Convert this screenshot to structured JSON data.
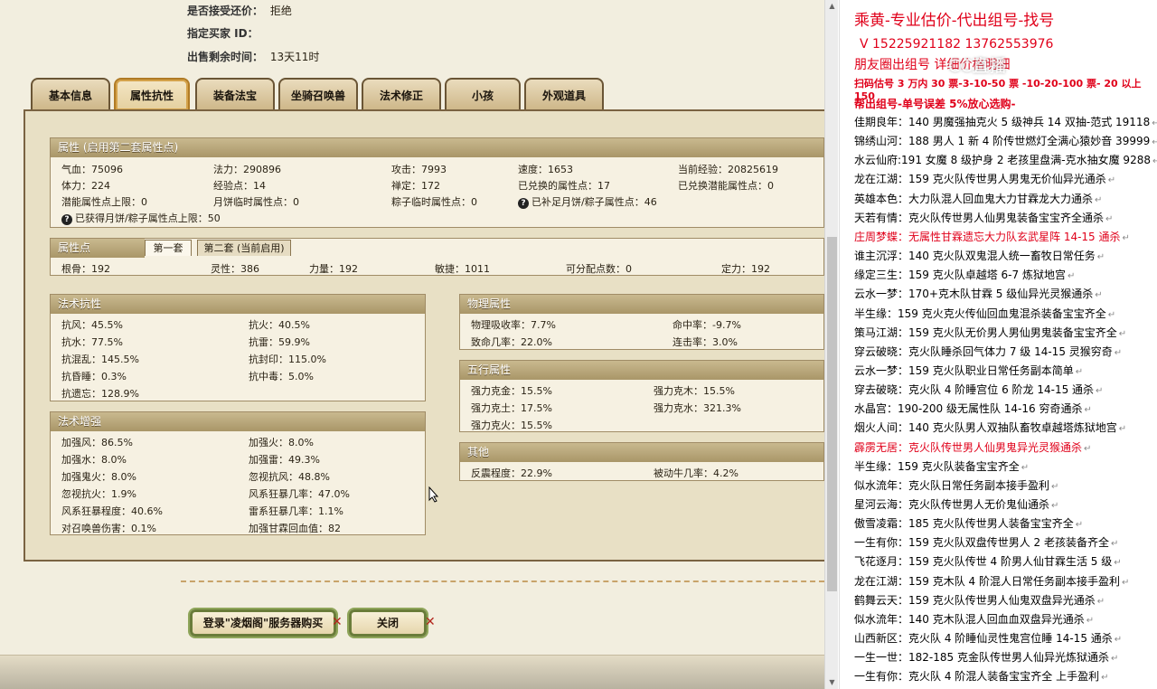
{
  "top_info": [
    {
      "label": "是否接受还价：",
      "value": "拒绝"
    },
    {
      "label": "指定买家 ID：",
      "value": ""
    },
    {
      "label": "出售剩余时间：",
      "value": "13天11时"
    }
  ],
  "tabs": [
    "基本信息",
    "属性抗性",
    "装备法宝",
    "坐骑召唤兽",
    "法术修正",
    "小孩",
    "外观道具"
  ],
  "attr_panel": {
    "title": "属性 (启用第二套属性点)",
    "rows": [
      [
        "气血：75096",
        "法力：290896",
        "攻击：7993",
        "速度：1653",
        "当前经验：20825619"
      ],
      [
        "体力：224",
        "经验点：14",
        "禅定：172",
        "已兑换的属性点：17",
        "已兑换潜能属性点：0"
      ],
      [
        "潜能属性点上限：0",
        "月饼临时属性点：0",
        "粽子临时属性点：0",
        "已补足月饼/粽子属性点：46",
        ""
      ],
      [
        "已获得月饼/粽子属性点上限：50",
        "",
        "",
        "",
        ""
      ]
    ]
  },
  "points_panel": {
    "title": "属性点",
    "subtab1": "第一套",
    "subtab2": "第二套 (当前启用)",
    "items": [
      "根骨：192",
      "灵性：386",
      "力量：192",
      "敏捷：1011",
      "可分配点数：0",
      "定力：192"
    ]
  },
  "magic_res": {
    "title": "法术抗性",
    "items": [
      "抗风：45.5%",
      "抗火：40.5%",
      "抗水：77.5%",
      "抗雷：59.9%",
      "抗混乱：145.5%",
      "抗封印：115.0%",
      "抗昏睡：0.3%",
      "抗中毒：5.0%",
      "抗遗忘：128.9%"
    ]
  },
  "magic_boost": {
    "title": "法术增强",
    "items": [
      "加强风：86.5%",
      "加强火：8.0%",
      "加强水：8.0%",
      "加强雷：49.3%",
      "加强鬼火：8.0%",
      "忽视抗风：48.8%",
      "忽视抗火：1.9%",
      "风系狂暴几率：47.0%",
      "风系狂暴程度：40.6%",
      "雷系狂暴几率：1.1%",
      "对召唤兽伤害：0.1%",
      "加强甘霖回血值：82"
    ]
  },
  "physical": {
    "title": "物理属性",
    "items": [
      "物理吸收率：7.7%",
      "命中率：-9.7%",
      "致命几率：22.0%",
      "连击率：3.0%"
    ]
  },
  "five_elements": {
    "title": "五行属性",
    "items": [
      "强力克金：15.5%",
      "强力克木：15.5%",
      "强力克土：17.5%",
      "强力克水：321.3%",
      "强力克火：15.5%"
    ]
  },
  "other": {
    "title": "其他",
    "items": [
      "反震程度：22.9%",
      "被动牛几率：4.2%"
    ]
  },
  "buttons": {
    "buy": "登录\"凌烟阁\"服务器购买",
    "close": "关闭"
  },
  "right": {
    "title": "乘黄-专业估价-代出组号-找号",
    "phones": "V 15225921182   13762553976",
    "moments": "朋友圈出组号   详细价格明细",
    "watermark": "CC直播",
    "price": "扫码估号 3 万内 30 票-3-10-50 票  -10-20-100 票- 20 以上 150",
    "guarantee": "帮出组号-单号误差 5%放心选购-",
    "listings": [
      {
        "text": "佳期良年：140 男魔强抽克火 5 级神兵 14 双抽-范式 19118",
        "red": false
      },
      {
        "text": "锦绣山河：188 男人 1 新 4 阶传世燃灯全满心猿妙音 39999",
        "red": false
      },
      {
        "text": "水云仙府:191 女魔 8 级护身 2 老孩里盘满-克水抽女魔 9288",
        "red": false
      },
      {
        "text": "龙在江湖：159 克火队传世男人男鬼无价仙异光通杀",
        "red": false
      },
      {
        "text": "英雄本色：大力队混人回血鬼大力甘霖龙大力通杀",
        "red": false
      },
      {
        "text": "天若有情：克火队传世男人仙男鬼装备宝宝齐全通杀",
        "red": false
      },
      {
        "text": "庄周梦蝶：无属性甘霖遗忘大力队玄武星阵 14-15 通杀",
        "red": true
      },
      {
        "text": "谁主沉浮：140 克火队双鬼混人统一畜牧日常任务",
        "red": false
      },
      {
        "text": "缘定三生：159 克火队卓越塔 6-7 炼狱地宫",
        "red": false
      },
      {
        "text": "云水一梦：170+克木队甘霖 5 级仙异光灵猴通杀",
        "red": false
      },
      {
        "text": "半生缘：159 克火克火传仙回血鬼混杀装备宝宝齐全",
        "red": false
      },
      {
        "text": "策马江湖：159 克火队无价男人男仙男鬼装备宝宝齐全",
        "red": false
      },
      {
        "text": "穿云破晓：克火队睡杀回气体力 7 级 14-15 灵猴穷奇",
        "red": false
      },
      {
        "text": "云水一梦：159 克火队职业日常任务副本简单",
        "red": false
      },
      {
        "text": "穿去破晓：克火队 4 阶睡宫位 6 阶龙 14-15 通杀",
        "red": false
      },
      {
        "text": "水晶宫：190-200 级无属性队 14-16 穷奇通杀",
        "red": false
      },
      {
        "text": "烟火人间：140 克火队男人双抽队畜牧卓越塔炼狱地宫",
        "red": false
      },
      {
        "text": "霹雳无居：克火队传世男人仙男鬼异光灵猴通杀",
        "red": true
      },
      {
        "text": "半生缘：159 克火队装备宝宝齐全",
        "red": false
      },
      {
        "text": "似水流年：克火队日常任务副本接手盈利",
        "red": false
      },
      {
        "text": "星河云海：克火队传世男人无价鬼仙通杀",
        "red": false
      },
      {
        "text": "傲雪凌霜：185 克火队传世男人装备宝宝齐全",
        "red": false
      },
      {
        "text": "一生有你：159 克火队双盘传世男人 2 老孩装备齐全",
        "red": false
      },
      {
        "text": "飞花逐月：159 克火队传世 4 阶男人仙甘霖生活 5 级",
        "red": false
      },
      {
        "text": "龙在江湖：159 克木队 4 阶混人日常任务副本接手盈利",
        "red": false
      },
      {
        "text": "鹤舞云天：159 克火队传世男人仙鬼双盘异光通杀",
        "red": false
      },
      {
        "text": "似水流年：140 克木队混人回血血双盘异光通杀",
        "red": false
      },
      {
        "text": "山西新区：克火队 4 阶睡仙灵性鬼宫位睡 14-15 通杀",
        "red": false
      },
      {
        "text": "一生一世：182-185 克金队传世男人仙异光炼狱通杀",
        "red": false
      },
      {
        "text": "一生有你：克火队 4 阶混人装备宝宝齐全 上手盈利",
        "red": false
      }
    ]
  }
}
